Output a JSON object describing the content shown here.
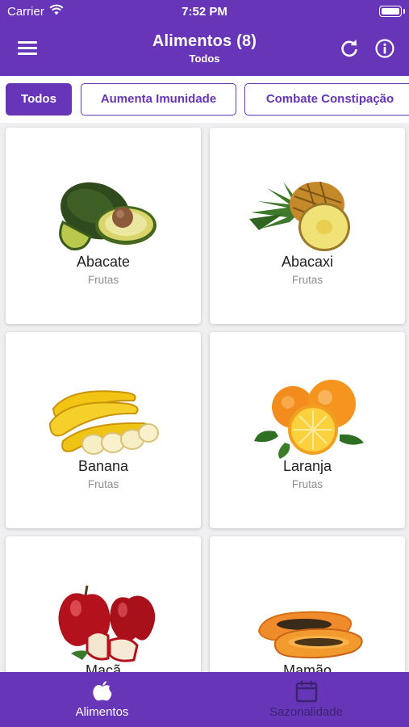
{
  "status_bar": {
    "carrier": "Carrier",
    "time": "7:52 PM"
  },
  "header": {
    "title": "Alimentos (8)",
    "subtitle": "Todos",
    "menu_icon": "hamburger-menu-icon",
    "refresh_icon": "refresh-icon",
    "info_icon": "info-icon"
  },
  "filters": [
    {
      "label": "Todos",
      "active": true
    },
    {
      "label": "Aumenta Imunidade",
      "active": false
    },
    {
      "label": "Combate Constipação",
      "active": false
    }
  ],
  "foods": [
    {
      "name": "Abacate",
      "category": "Frutas",
      "icon": "avocado-image"
    },
    {
      "name": "Abacaxi",
      "category": "Frutas",
      "icon": "pineapple-image"
    },
    {
      "name": "Banana",
      "category": "Frutas",
      "icon": "banana-image"
    },
    {
      "name": "Laranja",
      "category": "Frutas",
      "icon": "orange-image"
    },
    {
      "name": "Maçã",
      "category": "",
      "icon": "apple-image"
    },
    {
      "name": "Mamão",
      "category": "",
      "icon": "papaya-image"
    }
  ],
  "tabs": [
    {
      "label": "Alimentos",
      "icon": "apple-icon",
      "active": true
    },
    {
      "label": "Sazonalidade",
      "icon": "calendar-icon",
      "active": false
    }
  ],
  "colors": {
    "primary": "#6735b8",
    "inactive_tab": "#3a2470",
    "card_bg": "#ffffff",
    "secondary_text": "#8f8f8f"
  }
}
